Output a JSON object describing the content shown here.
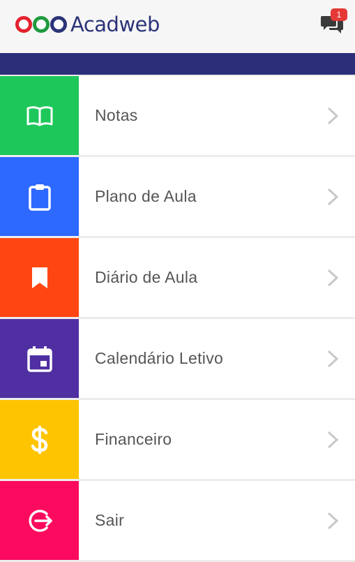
{
  "app": {
    "name": "Acadweb",
    "logo_colors": [
      "#e5222f",
      "#1f9a3f",
      "#2b3378"
    ],
    "header_bar_color": "#2b2f7a"
  },
  "notifications": {
    "count": "1",
    "icon": "chat-bubbles-icon",
    "badge_color": "#e53935"
  },
  "menu": {
    "items": [
      {
        "label": "Notas",
        "icon": "open-book-icon",
        "color": "#1ec75a"
      },
      {
        "label": "Plano de Aula",
        "icon": "clipboard-icon",
        "color": "#2d68ff"
      },
      {
        "label": "Diário de Aula",
        "icon": "bookmark-icon",
        "color": "#ff4612"
      },
      {
        "label": "Calendário Letivo",
        "icon": "calendar-icon",
        "color": "#4f2fa1"
      },
      {
        "label": "Financeiro",
        "icon": "dollar-icon",
        "color": "#ffc400"
      },
      {
        "label": "Sair",
        "icon": "logout-icon",
        "color": "#fb0a5f"
      }
    ]
  }
}
